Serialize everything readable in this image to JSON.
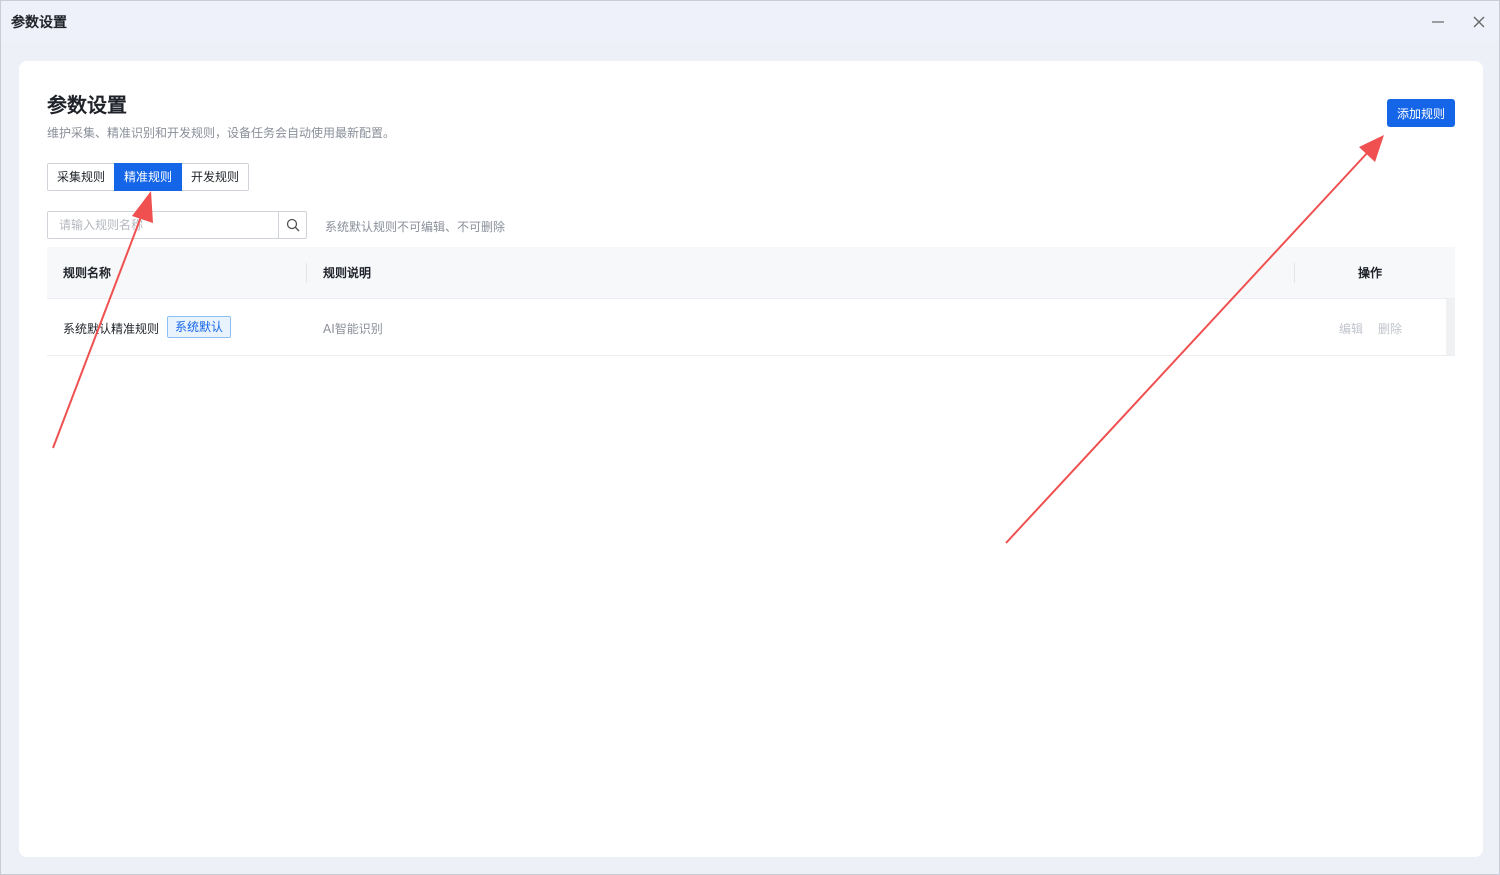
{
  "window": {
    "title": "参数设置"
  },
  "header": {
    "title": "参数设置",
    "subtitle": "维护采集、精准识别和开发规则，设备任务会自动使用最新配置。",
    "add_button": "添加规则"
  },
  "tabs": [
    {
      "label": "采集规则",
      "active": false
    },
    {
      "label": "精准规则",
      "active": true
    },
    {
      "label": "开发规则",
      "active": false
    }
  ],
  "search": {
    "placeholder": "请输入规则名称",
    "value": "",
    "hint": "系统默认规则不可编辑、不可删除"
  },
  "table": {
    "columns": [
      "规则名称",
      "规则说明",
      "操作"
    ],
    "rows": [
      {
        "name": "系统默认精准规则",
        "tag": "系统默认",
        "description": "AI智能识别",
        "actions": [
          "编辑",
          "删除"
        ]
      }
    ]
  },
  "colors": {
    "accent": "#1565e8",
    "annotation_arrow": "#f05050"
  },
  "icons": {
    "search": "search-icon",
    "minimize": "minimize-icon",
    "close": "close-icon"
  }
}
